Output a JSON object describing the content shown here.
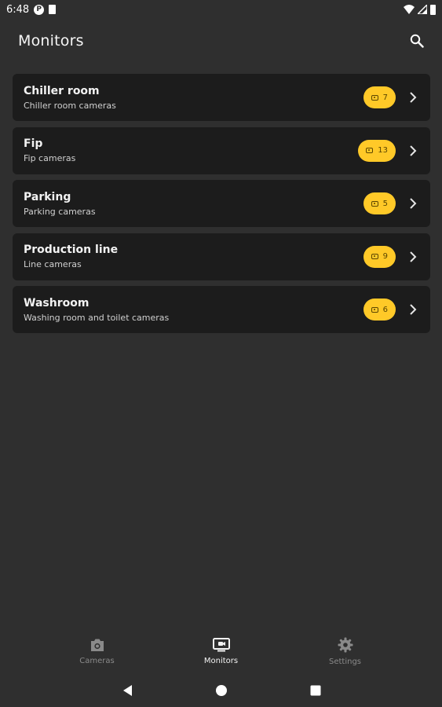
{
  "status_bar": {
    "time": "6:48",
    "p_badge": "P"
  },
  "app_bar": {
    "title": "Monitors",
    "search_icon": "search-icon"
  },
  "monitors": [
    {
      "title": "Chiller room",
      "subtitle": "Chiller room cameras",
      "count": "7"
    },
    {
      "title": "Fip",
      "subtitle": "Fip cameras",
      "count": "13"
    },
    {
      "title": "Parking",
      "subtitle": "Parking cameras",
      "count": "5"
    },
    {
      "title": "Production line",
      "subtitle": "Line cameras",
      "count": "9"
    },
    {
      "title": "Washroom",
      "subtitle": "Washing room and toilet cameras",
      "count": "6"
    }
  ],
  "bottom_nav": [
    {
      "label": "Cameras",
      "icon": "camera-icon",
      "active": false
    },
    {
      "label": "Monitors",
      "icon": "monitor-icon",
      "active": true
    },
    {
      "label": "Settings",
      "icon": "gear-icon",
      "active": false
    }
  ],
  "colors": {
    "background": "#2f2f2f",
    "card": "#1c1c1c",
    "accent": "#ffc928"
  }
}
